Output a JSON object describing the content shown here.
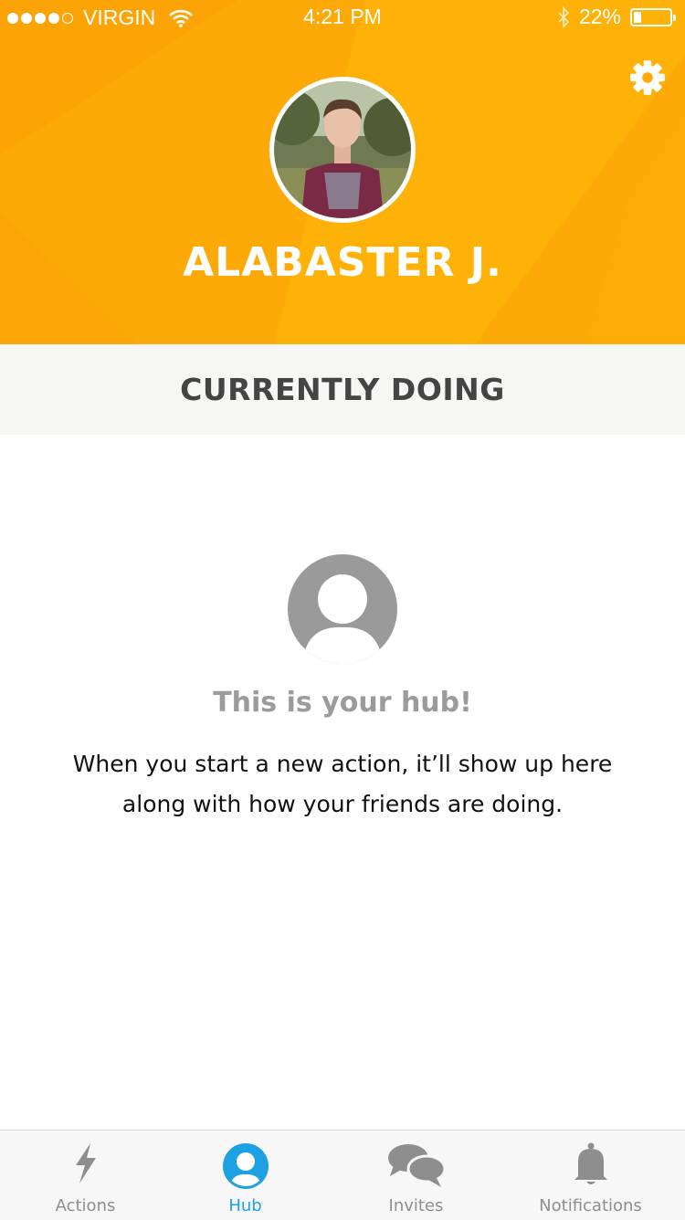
{
  "status_bar": {
    "signal_dots_filled": 4,
    "signal_dots_total": 5,
    "carrier": "VIRGIN",
    "time": "4:21 PM",
    "battery_percent_label": "22%",
    "battery_level": 0.22,
    "icons": [
      "wifi-icon",
      "bluetooth-icon",
      "battery-icon"
    ]
  },
  "header": {
    "background_color": "#fdaa08",
    "settings_icon": "gear-icon",
    "profile_name": "ALABASTER J."
  },
  "section": {
    "title": "CURRENTLY DOING"
  },
  "empty_state": {
    "icon": "user-placeholder-icon",
    "title": "This is your hub!",
    "body": "When you start a new action, it’ll show up here along with how your friends are doing."
  },
  "tab_bar": {
    "active_color": "#1da1e2",
    "inactive_color": "#8e8e8e",
    "tabs": [
      {
        "label": "Actions",
        "icon": "lightning-icon",
        "active": false
      },
      {
        "label": "Hub",
        "icon": "user-icon",
        "active": true
      },
      {
        "label": "Invites",
        "icon": "chat-bubbles-icon",
        "active": false
      },
      {
        "label": "Notifications",
        "icon": "bell-icon",
        "active": false
      }
    ]
  }
}
